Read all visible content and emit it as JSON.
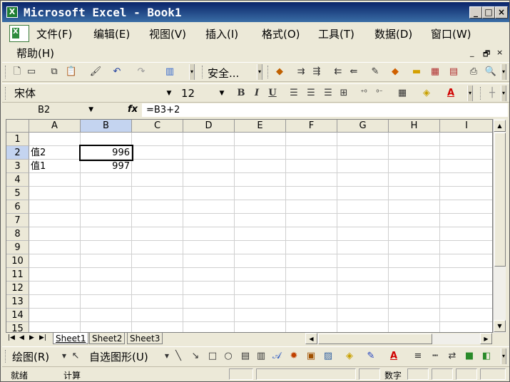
{
  "window": {
    "title": "Microsoft Excel - Book1",
    "app_icon": "X",
    "minimize": "_",
    "maximize": "□",
    "close": "×"
  },
  "menu": {
    "items": [
      "文件(F)",
      "编辑(E)",
      "视图(V)",
      "插入(I)",
      "格式(O)",
      "工具(T)",
      "数据(D)",
      "窗口(W)",
      "帮助(H)"
    ],
    "mdi_buttons": [
      "_",
      "🗗",
      "×"
    ]
  },
  "standard_toolbar": {
    "security_label": "安全...",
    "icons": [
      "new-icon",
      "open-icon",
      "copy-icon",
      "paste-icon",
      "format-painter-icon",
      "undo-icon",
      "redo-icon",
      "chart-wizard-icon",
      "security-icon",
      "insert-rows-icon",
      "insert-cols-icon",
      "delete-rows-icon",
      "delete-cols-icon",
      "clear-icon",
      "warning-icon",
      "folder-icon",
      "table-icon",
      "print-icon",
      "zoom-icon"
    ]
  },
  "formatting_toolbar": {
    "font_name": "宋体",
    "font_size": "12",
    "bold": "B",
    "italic": "I",
    "underline": "U",
    "percent": "%",
    "comma": ",",
    "font_color_letter": "A"
  },
  "formula_bar": {
    "name_box": "B2",
    "fx": "fx",
    "formula": "=B3+2"
  },
  "grid": {
    "columns": [
      "A",
      "B",
      "C",
      "D",
      "E",
      "F",
      "G",
      "H",
      "I"
    ],
    "rows": [
      "1",
      "2",
      "3",
      "4",
      "5",
      "6",
      "7",
      "8",
      "9",
      "10",
      "11",
      "12",
      "13",
      "14",
      "15"
    ],
    "cells": {
      "A2": "值2",
      "B2": "996",
      "A3": "值1",
      "B3": "997"
    },
    "active_cell": "B2"
  },
  "sheets": {
    "tabs": [
      "Sheet1",
      "Sheet2",
      "Sheet3"
    ],
    "active": "Sheet1"
  },
  "drawing_toolbar": {
    "draw_label": "绘图(R)",
    "autoshapes_label": "自选图形(U)"
  },
  "status_bar": {
    "ready": "就绪",
    "calculate": "计算",
    "num_lock": "数字"
  }
}
